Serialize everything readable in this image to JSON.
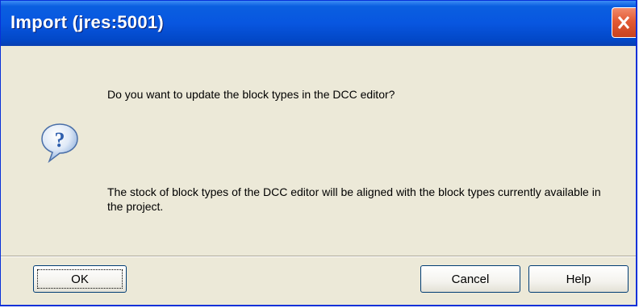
{
  "window": {
    "title": "Import (jres:5001)"
  },
  "dialog": {
    "question": "Do you want to update the block types in the DCC editor?",
    "details": "The stock of block types of the DCC editor will be aligned with the block types currently available in the project.",
    "icon": "question-icon"
  },
  "buttons": {
    "ok": "OK",
    "cancel": "Cancel",
    "help": "Help"
  },
  "colors": {
    "titlebar": "#0856e0",
    "close_button": "#e25a34",
    "dialog_background": "#ece9d8",
    "icon_blue": "#2f5fae"
  }
}
